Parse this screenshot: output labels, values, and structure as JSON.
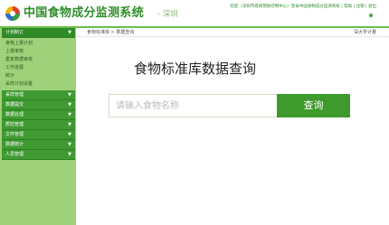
{
  "header": {
    "title": "中国食物成分监测系统",
    "subtitle": "- 深圳",
    "info": "欢迎（深圳市疾病预防控制中心）登录中国食物成分监测系统 | 帮助 | 注销 | 退出"
  },
  "sidebar": {
    "sections": [
      {
        "label": "计划制订",
        "expanded": true,
        "items": [
          "食物上报计划",
          "上报审核",
          "重复数据审核",
          "工作进展",
          "统计",
          "采样计划设置"
        ]
      },
      {
        "label": "采样管理",
        "expanded": false
      },
      {
        "label": "数据提交",
        "expanded": false
      },
      {
        "label": "数据处理",
        "expanded": false
      },
      {
        "label": "质控管理",
        "expanded": false
      },
      {
        "label": "文件管理",
        "expanded": false
      },
      {
        "label": "数据统计",
        "expanded": false
      },
      {
        "label": "人员管理",
        "expanded": false
      }
    ]
  },
  "main": {
    "breadcrumb": "食物标准库 > 数据查询",
    "user": "深大学计量",
    "title": "食物标准库数据查询",
    "search": {
      "placeholder": "请输入食物名称",
      "value": "",
      "button_label": "查询"
    }
  },
  "colors": {
    "brand": "#2f8e2a",
    "sidebar_bg": "#9fd07a",
    "menu_header": "#3f9a31",
    "button": "#3e9a2c"
  }
}
